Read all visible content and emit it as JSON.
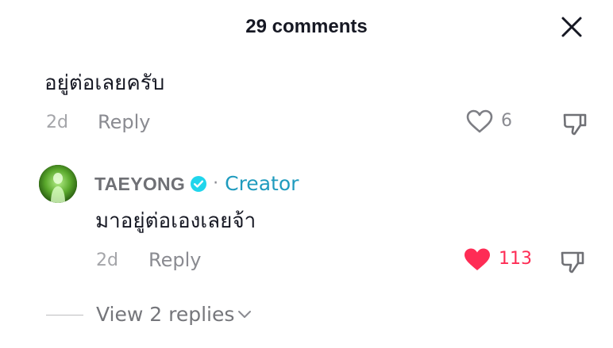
{
  "header": {
    "title": "29 comments"
  },
  "comments": [
    {
      "text": "อยู่ต่อเลยครับ",
      "time": "2d",
      "reply_label": "Reply",
      "likes": "6",
      "liked": false
    },
    {
      "author": "TAEYONG",
      "verified": true,
      "separator": "·",
      "badge": "Creator",
      "text": "มาอยู่ต่อเองเลยจ้า",
      "time": "2d",
      "reply_label": "Reply",
      "likes": "113",
      "liked": true,
      "view_replies": "View 2 replies"
    }
  ],
  "colors": {
    "text": "#161823",
    "muted": "#8a8b91",
    "like_active": "#fe2c55",
    "creator_badge": "#1f9bbe",
    "verified": "#20d5ec"
  },
  "icons": {
    "close": "close-icon",
    "heart": "heart-outline-icon",
    "heart_filled": "heart-filled-icon",
    "dislike": "thumbs-down-icon",
    "verified": "verified-check-icon",
    "chevron": "chevron-down-icon"
  }
}
